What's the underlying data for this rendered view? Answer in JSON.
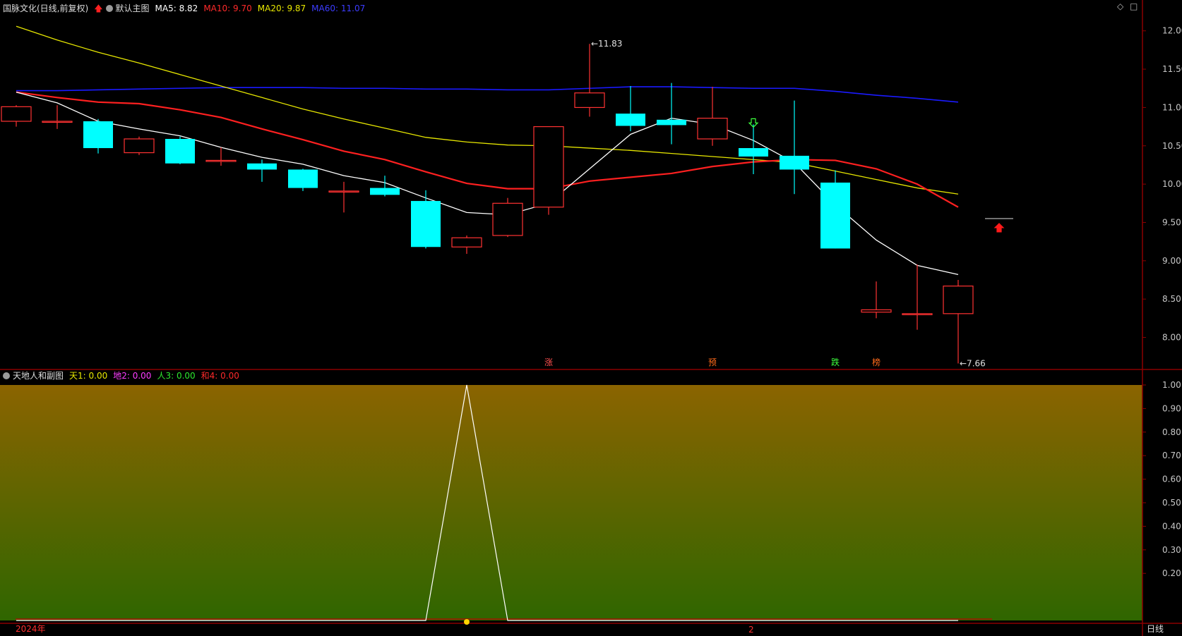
{
  "main_panel": {
    "title": "国脉文化(日线,前复权)",
    "template": "默认主图",
    "ma_labels": [
      {
        "text": "MA5: 8.82",
        "color": "#ffffff"
      },
      {
        "text": "MA10: 9.70",
        "color": "#ff2a2a"
      },
      {
        "text": "MA20: 9.87",
        "color": "#e8e800"
      },
      {
        "text": "MA60: 11.07",
        "color": "#3c3cff"
      }
    ],
    "controls": [
      "◇",
      "□"
    ]
  },
  "sub_panel": {
    "title": "天地人和副图",
    "indicators": [
      {
        "text": "天1: 0.00",
        "color": "#e8e800"
      },
      {
        "text": "地2: 0.00",
        "color": "#ff3cff"
      },
      {
        "text": "人3: 0.00",
        "color": "#2ee82e"
      },
      {
        "text": "和4: 0.00",
        "color": "#ff2a2a"
      }
    ]
  },
  "bottom_bar": {
    "year_label": "2024年",
    "month_label": "2",
    "period_label": "日线"
  },
  "colors": {
    "up": "#ff3232",
    "down": "#00ffff",
    "grid": "#8b0000",
    "axis_text": "#c8c8c8",
    "ma5": "#ffffff",
    "ma10": "#ff2020",
    "ma20": "#e6e600",
    "ma60": "#1a1aff"
  },
  "chart_data": [
    {
      "type": "candlestick",
      "ylim": [
        7.6,
        12.2
      ],
      "y_ticks": [
        12.0,
        11.5,
        11.0,
        10.5,
        10.0,
        9.5,
        9.0,
        8.5,
        8.0
      ],
      "y_tick_labels": [
        "12.00",
        "11.50",
        "11.00",
        "10.50",
        "10.00",
        "9.50",
        "9.00",
        "8.50",
        "8.00"
      ],
      "candles": [
        {
          "o": 10.82,
          "h": 11.03,
          "l": 10.75,
          "c": 11.01
        },
        {
          "o": 10.82,
          "h": 11.03,
          "l": 10.72,
          "c": 10.82
        },
        {
          "o": 10.82,
          "h": 10.85,
          "l": 10.4,
          "c": 10.47
        },
        {
          "o": 10.41,
          "h": 10.62,
          "l": 10.38,
          "c": 10.59
        },
        {
          "o": 10.59,
          "h": 10.62,
          "l": 10.26,
          "c": 10.27
        },
        {
          "o": 10.31,
          "h": 10.48,
          "l": 10.24,
          "c": 10.31
        },
        {
          "o": 10.27,
          "h": 10.32,
          "l": 10.03,
          "c": 10.19
        },
        {
          "o": 10.19,
          "h": 10.2,
          "l": 9.91,
          "c": 9.95
        },
        {
          "o": 9.91,
          "h": 10.03,
          "l": 9.63,
          "c": 9.91
        },
        {
          "o": 9.95,
          "h": 10.11,
          "l": 9.84,
          "c": 9.86
        },
        {
          "o": 9.78,
          "h": 9.92,
          "l": 9.16,
          "c": 9.18
        },
        {
          "o": 9.18,
          "h": 9.33,
          "l": 9.09,
          "c": 9.3
        },
        {
          "o": 9.33,
          "h": 9.82,
          "l": 9.31,
          "c": 9.75
        },
        {
          "o": 9.7,
          "h": 10.75,
          "l": 9.6,
          "c": 10.75
        },
        {
          "o": 11.0,
          "h": 11.83,
          "l": 10.88,
          "c": 11.19
        },
        {
          "o": 10.92,
          "h": 11.28,
          "l": 10.69,
          "c": 10.76
        },
        {
          "o": 10.84,
          "h": 11.32,
          "l": 10.52,
          "c": 10.77
        },
        {
          "o": 10.59,
          "h": 11.27,
          "l": 10.5,
          "c": 10.86
        },
        {
          "o": 10.47,
          "h": 10.78,
          "l": 10.13,
          "c": 10.36
        },
        {
          "o": 10.37,
          "h": 11.09,
          "l": 9.87,
          "c": 10.19
        },
        {
          "o": 10.02,
          "h": 10.18,
          "l": 9.16,
          "c": 9.16
        },
        {
          "o": 8.33,
          "h": 8.73,
          "l": 8.25,
          "c": 8.36
        },
        {
          "o": 8.3,
          "h": 8.95,
          "l": 8.1,
          "c": 8.31
        },
        {
          "o": 8.31,
          "h": 8.75,
          "l": 7.66,
          "c": 8.67
        }
      ],
      "ma5": [
        11.2,
        11.06,
        10.82,
        10.72,
        10.63,
        10.48,
        10.35,
        10.26,
        10.11,
        10.02,
        9.82,
        9.63,
        9.6,
        9.75,
        10.2,
        10.65,
        10.86,
        10.78,
        10.57,
        10.28,
        9.73,
        9.27,
        8.94,
        8.82
      ],
      "ma10": [
        11.2,
        11.13,
        11.07,
        11.05,
        10.97,
        10.87,
        10.72,
        10.58,
        10.43,
        10.32,
        10.16,
        10.01,
        9.94,
        9.94,
        10.04,
        10.09,
        10.14,
        10.23,
        10.29,
        10.32,
        10.31,
        10.2,
        10.0,
        9.7
      ],
      "ma20": [
        12.06,
        11.88,
        11.72,
        11.58,
        11.43,
        11.28,
        11.13,
        10.98,
        10.85,
        10.73,
        10.61,
        10.55,
        10.51,
        10.5,
        10.47,
        10.44,
        10.4,
        10.36,
        10.32,
        10.28,
        10.17,
        10.06,
        9.95,
        9.87
      ],
      "ma60": [
        11.22,
        11.22,
        11.23,
        11.24,
        11.25,
        11.26,
        11.26,
        11.26,
        11.25,
        11.25,
        11.24,
        11.24,
        11.23,
        11.23,
        11.25,
        11.27,
        11.27,
        11.26,
        11.25,
        11.25,
        11.21,
        11.16,
        11.12,
        11.07
      ],
      "annotations": [
        {
          "text": "11.83",
          "candle": 14,
          "value": 11.83
        },
        {
          "text": "7.66",
          "candle": 23,
          "value": 7.66
        }
      ],
      "signals": [
        {
          "text": "涨",
          "candle": 13,
          "color": "#ff5050"
        },
        {
          "text": "预",
          "candle": 17,
          "color": "#ff6a1a"
        },
        {
          "text": "跌",
          "candle": 20,
          "color": "#3cff3c"
        },
        {
          "text": "榜",
          "candle": 21,
          "color": "#ff6a1a"
        }
      ],
      "arrows": [
        {
          "direction": "down",
          "candle": 18,
          "value": 10.78,
          "color": "#3cff3c"
        },
        {
          "direction": "up",
          "candle": 24,
          "value": 9.45,
          "color": "#ff1a1a"
        }
      ],
      "last_price": 9.55
    },
    {
      "type": "line",
      "ylim": [
        0,
        1.0
      ],
      "y_ticks": [
        1.0,
        0.9,
        0.8,
        0.7,
        0.6,
        0.5,
        0.4,
        0.3,
        0.2
      ],
      "y_tick_labels": [
        "1.00",
        "0.90",
        "0.80",
        "0.70",
        "0.60",
        "0.50",
        "0.40",
        "0.30",
        "0.20"
      ],
      "series": [
        {
          "values": [
            0,
            0,
            0,
            0,
            0,
            0,
            0,
            0,
            0,
            0,
            0,
            1,
            0,
            0,
            0,
            0,
            0,
            0,
            0,
            0,
            0,
            0,
            0,
            0
          ]
        }
      ]
    }
  ]
}
